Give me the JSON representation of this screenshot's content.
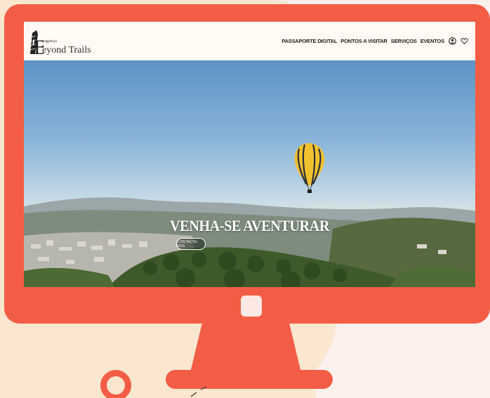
{
  "site": {
    "logo": {
      "top_text": "ragança",
      "main_text": "eyond Trails",
      "letter": "B"
    },
    "nav": {
      "items": [
        {
          "label": "PASSAPORTE DIGITAL"
        },
        {
          "label": "PONTOS A VISITAR"
        },
        {
          "label": "SERVIÇOS"
        },
        {
          "label": "EVENTOS"
        }
      ],
      "icons": [
        "user-circle-icon",
        "heart-icon"
      ]
    }
  },
  "hero": {
    "title": "VENHA-SE AVENTURAR",
    "cta_label": "CONTACTE-NOS"
  },
  "colors": {
    "monitor": "#f45d45",
    "header_bg": "#fefaf4",
    "page_bg": "#fdf1ee",
    "blob": "#fbe6cf",
    "balloon": "#f2c12e"
  }
}
